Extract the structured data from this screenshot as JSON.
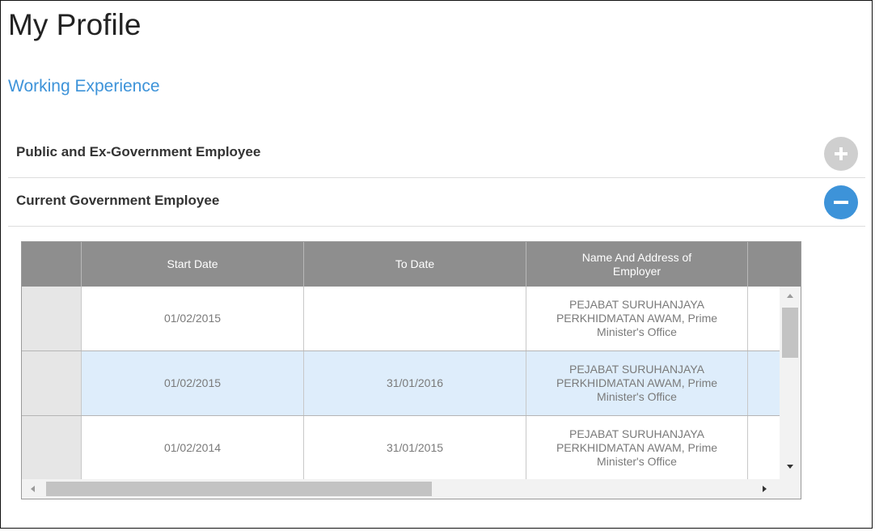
{
  "page": {
    "title": "My Profile",
    "section_title": "Working Experience"
  },
  "accordion": [
    {
      "label": "Public and Ex-Government Employee",
      "state": "collapsed",
      "icon": "plus-icon"
    },
    {
      "label": "Current Government Employee",
      "state": "expanded",
      "icon": "minus-icon"
    }
  ],
  "colors": {
    "accent": "#3d93d9",
    "header_bg": "#8e8e8e",
    "selected_row": "#deedfb",
    "collapsed_button": "#cfcfcf"
  },
  "grid": {
    "columns": [
      "",
      "Start Date",
      "To Date",
      "Name And Address of Employer",
      ""
    ],
    "rows": [
      {
        "start": "01/02/2015",
        "to": "",
        "employer": "PEJABAT SURUHANJAYA PERKHIDMATAN AWAM, Prime Minister's Office",
        "selected": false
      },
      {
        "start": "01/02/2015",
        "to": "31/01/2016",
        "employer": "PEJABAT SURUHANJAYA PERKHIDMATAN AWAM, Prime Minister's Office",
        "selected": true
      },
      {
        "start": "01/02/2014",
        "to": "31/01/2015",
        "employer": "PEJABAT SURUHANJAYA PERKHIDMATAN AWAM, Prime Minister's Office",
        "selected": false
      }
    ]
  }
}
